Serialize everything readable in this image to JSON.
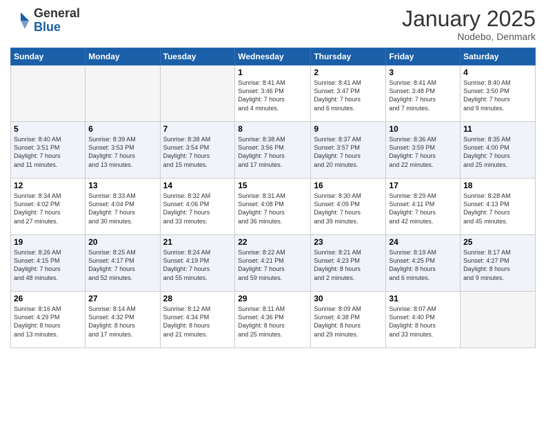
{
  "logo": {
    "general": "General",
    "blue": "Blue"
  },
  "title": "January 2025",
  "location": "Nodebo, Denmark",
  "days_header": [
    "Sunday",
    "Monday",
    "Tuesday",
    "Wednesday",
    "Thursday",
    "Friday",
    "Saturday"
  ],
  "weeks": [
    [
      {
        "day": "",
        "text": ""
      },
      {
        "day": "",
        "text": ""
      },
      {
        "day": "",
        "text": ""
      },
      {
        "day": "1",
        "text": "Sunrise: 8:41 AM\nSunset: 3:46 PM\nDaylight: 7 hours\nand 4 minutes."
      },
      {
        "day": "2",
        "text": "Sunrise: 8:41 AM\nSunset: 3:47 PM\nDaylight: 7 hours\nand 6 minutes."
      },
      {
        "day": "3",
        "text": "Sunrise: 8:41 AM\nSunset: 3:48 PM\nDaylight: 7 hours\nand 7 minutes."
      },
      {
        "day": "4",
        "text": "Sunrise: 8:40 AM\nSunset: 3:50 PM\nDaylight: 7 hours\nand 9 minutes."
      }
    ],
    [
      {
        "day": "5",
        "text": "Sunrise: 8:40 AM\nSunset: 3:51 PM\nDaylight: 7 hours\nand 11 minutes."
      },
      {
        "day": "6",
        "text": "Sunrise: 8:39 AM\nSunset: 3:53 PM\nDaylight: 7 hours\nand 13 minutes."
      },
      {
        "day": "7",
        "text": "Sunrise: 8:38 AM\nSunset: 3:54 PM\nDaylight: 7 hours\nand 15 minutes."
      },
      {
        "day": "8",
        "text": "Sunrise: 8:38 AM\nSunset: 3:56 PM\nDaylight: 7 hours\nand 17 minutes."
      },
      {
        "day": "9",
        "text": "Sunrise: 8:37 AM\nSunset: 3:57 PM\nDaylight: 7 hours\nand 20 minutes."
      },
      {
        "day": "10",
        "text": "Sunrise: 8:36 AM\nSunset: 3:59 PM\nDaylight: 7 hours\nand 22 minutes."
      },
      {
        "day": "11",
        "text": "Sunrise: 8:35 AM\nSunset: 4:00 PM\nDaylight: 7 hours\nand 25 minutes."
      }
    ],
    [
      {
        "day": "12",
        "text": "Sunrise: 8:34 AM\nSunset: 4:02 PM\nDaylight: 7 hours\nand 27 minutes."
      },
      {
        "day": "13",
        "text": "Sunrise: 8:33 AM\nSunset: 4:04 PM\nDaylight: 7 hours\nand 30 minutes."
      },
      {
        "day": "14",
        "text": "Sunrise: 8:32 AM\nSunset: 4:06 PM\nDaylight: 7 hours\nand 33 minutes."
      },
      {
        "day": "15",
        "text": "Sunrise: 8:31 AM\nSunset: 4:08 PM\nDaylight: 7 hours\nand 36 minutes."
      },
      {
        "day": "16",
        "text": "Sunrise: 8:30 AM\nSunset: 4:09 PM\nDaylight: 7 hours\nand 39 minutes."
      },
      {
        "day": "17",
        "text": "Sunrise: 8:29 AM\nSunset: 4:11 PM\nDaylight: 7 hours\nand 42 minutes."
      },
      {
        "day": "18",
        "text": "Sunrise: 8:28 AM\nSunset: 4:13 PM\nDaylight: 7 hours\nand 45 minutes."
      }
    ],
    [
      {
        "day": "19",
        "text": "Sunrise: 8:26 AM\nSunset: 4:15 PM\nDaylight: 7 hours\nand 48 minutes."
      },
      {
        "day": "20",
        "text": "Sunrise: 8:25 AM\nSunset: 4:17 PM\nDaylight: 7 hours\nand 52 minutes."
      },
      {
        "day": "21",
        "text": "Sunrise: 8:24 AM\nSunset: 4:19 PM\nDaylight: 7 hours\nand 55 minutes."
      },
      {
        "day": "22",
        "text": "Sunrise: 8:22 AM\nSunset: 4:21 PM\nDaylight: 7 hours\nand 59 minutes."
      },
      {
        "day": "23",
        "text": "Sunrise: 8:21 AM\nSunset: 4:23 PM\nDaylight: 8 hours\nand 2 minutes."
      },
      {
        "day": "24",
        "text": "Sunrise: 8:19 AM\nSunset: 4:25 PM\nDaylight: 8 hours\nand 6 minutes."
      },
      {
        "day": "25",
        "text": "Sunrise: 8:17 AM\nSunset: 4:27 PM\nDaylight: 8 hours\nand 9 minutes."
      }
    ],
    [
      {
        "day": "26",
        "text": "Sunrise: 8:16 AM\nSunset: 4:29 PM\nDaylight: 8 hours\nand 13 minutes."
      },
      {
        "day": "27",
        "text": "Sunrise: 8:14 AM\nSunset: 4:32 PM\nDaylight: 8 hours\nand 17 minutes."
      },
      {
        "day": "28",
        "text": "Sunrise: 8:12 AM\nSunset: 4:34 PM\nDaylight: 8 hours\nand 21 minutes."
      },
      {
        "day": "29",
        "text": "Sunrise: 8:11 AM\nSunset: 4:36 PM\nDaylight: 8 hours\nand 25 minutes."
      },
      {
        "day": "30",
        "text": "Sunrise: 8:09 AM\nSunset: 4:38 PM\nDaylight: 8 hours\nand 29 minutes."
      },
      {
        "day": "31",
        "text": "Sunrise: 8:07 AM\nSunset: 4:40 PM\nDaylight: 8 hours\nand 33 minutes."
      },
      {
        "day": "",
        "text": ""
      }
    ]
  ]
}
